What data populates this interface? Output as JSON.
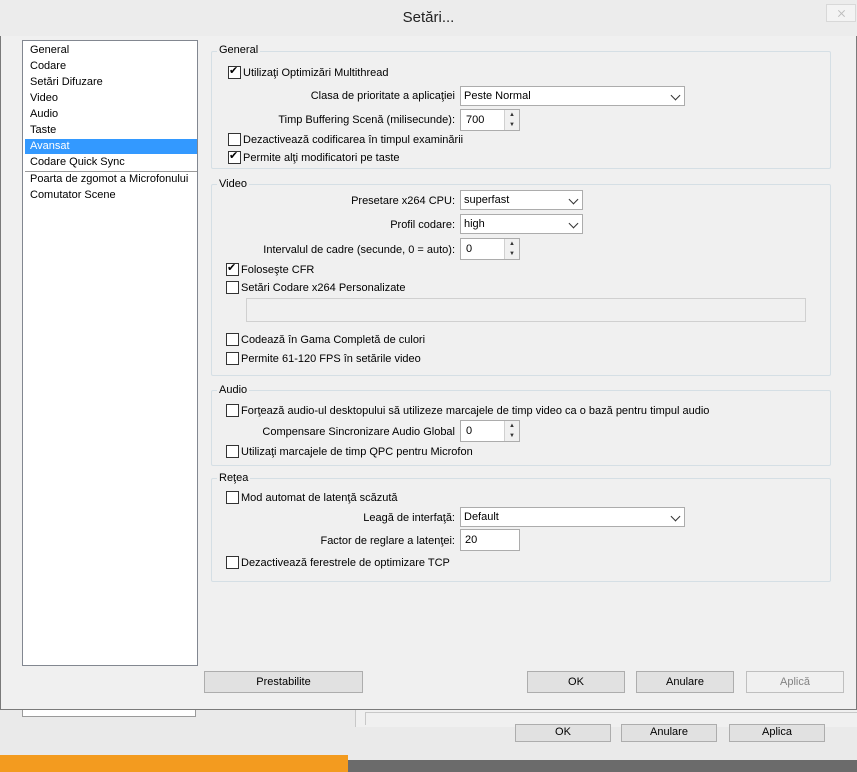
{
  "window": {
    "title": "Setări..."
  },
  "sidebar": {
    "items": [
      {
        "label": "General"
      },
      {
        "label": "Codare"
      },
      {
        "label": "Setări Difuzare"
      },
      {
        "label": "Video"
      },
      {
        "label": "Audio"
      },
      {
        "label": "Taste"
      },
      {
        "label": "Avansat",
        "selected": true
      },
      {
        "label": "Codare Quick Sync"
      },
      {
        "label": "Poarta de zgomot a Microfonului"
      },
      {
        "label": "Comutator Scene"
      }
    ]
  },
  "general": {
    "title": "General",
    "multithread_label": "Utilizaţi Optimizări Multithread",
    "multithread_checked": true,
    "priority_label": "Clasa de prioritate a aplicaţiei",
    "priority_value": "Peste Normal",
    "buffering_label": "Timp Buffering Scenă (milisecunde):",
    "buffering_value": "700",
    "disable_preview_label": "Dezactivează codificarea în timpul examinării",
    "disable_preview_checked": false,
    "allow_modifiers_label": "Permite alţi modificatori pe taste",
    "allow_modifiers_checked": true
  },
  "video": {
    "title": "Video",
    "preset_label": "Presetare x264 CPU:",
    "preset_value": "superfast",
    "profile_label": "Profil codare:",
    "profile_value": "high",
    "keyframe_label": "Intervalul de cadre (secunde, 0 = auto):",
    "keyframe_value": "0",
    "cfr_label": "Foloseşte CFR",
    "cfr_checked": true,
    "custom_label": "Setări Codare x264 Personalizate",
    "custom_checked": false,
    "fullrange_label": "Codează în Gama Completă de culori",
    "fullrange_checked": false,
    "highfps_label": "Permite 61-120 FPS în setările video",
    "highfps_checked": false
  },
  "audio": {
    "title": "Audio",
    "force_label": "Forţează audio-ul desktopului să utilizeze marcajele de timp video ca o bază pentru timpul audio",
    "force_checked": false,
    "sync_label": "Compensare Sincronizare Audio Global",
    "sync_value": "0",
    "qpc_label": "Utilizaţi marcajele de timp QPC pentru Microfon",
    "qpc_checked": false
  },
  "network": {
    "title": "Reţea",
    "latency_label": "Mod automat de latenţă scăzută",
    "latency_checked": false,
    "bind_label": "Leagă de interfaţă:",
    "bind_value": "Default",
    "factor_label": "Factor de reglare a latenţei:",
    "factor_value": "20",
    "tcp_label": "Dezactivează ferestrele de optimizare TCP",
    "tcp_checked": false
  },
  "buttons": {
    "defaults": "Prestabilite",
    "ok": "OK",
    "cancel": "Anulare",
    "apply": "Aplică"
  },
  "background_window": {
    "ok": "OK",
    "cancel": "Anulare",
    "apply": "Aplica"
  }
}
